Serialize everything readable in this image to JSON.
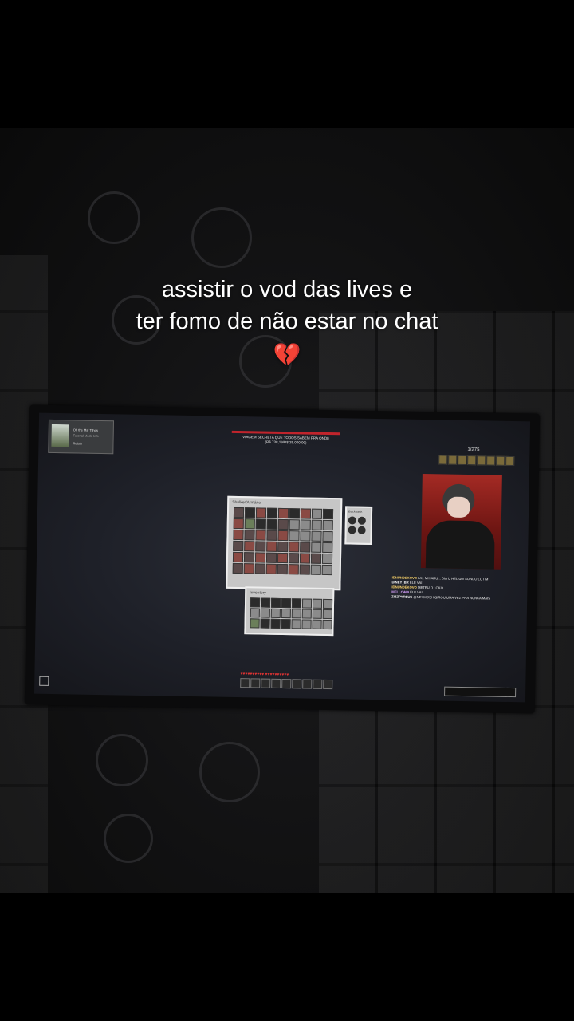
{
  "overlay": {
    "line1": "assistir o vod das lives e",
    "line2": "ter fomo de não estar no chat",
    "emoji": "💔"
  },
  "game": {
    "advancement": {
      "title": "Oh the Mal Tilhgs",
      "subtitle": "Tutorial Mode Info",
      "note": "Relato"
    },
    "bossbar": {
      "line1": "VIAGEM SECRETA QUE TODOS SABEM PRA ONDE",
      "line2": "(R$ 738,19/R$ 25.000,00)"
    },
    "container_title": "Shulker/Armário",
    "inventory_title": "Inventory",
    "side_panel_title": "Backpack",
    "counter": "1/275",
    "chat": [
      {
        "name": "IDNUNDEKOVO",
        "text": "LA1 MIHARU... DIA U HELIUM SONDO LOTIM"
      },
      {
        "name": "DINEY_BR",
        "text": "ELE VAI"
      },
      {
        "name": "IDNUNDEKOVO",
        "text": "METEU O LOKO"
      },
      {
        "name": "MELLO469",
        "text": "ELE VAI"
      },
      {
        "name": "ZIZZPYREUS",
        "text": "@NEYMOSH GIROU UMA VEZ PRA NUNCA MAIS"
      }
    ]
  }
}
